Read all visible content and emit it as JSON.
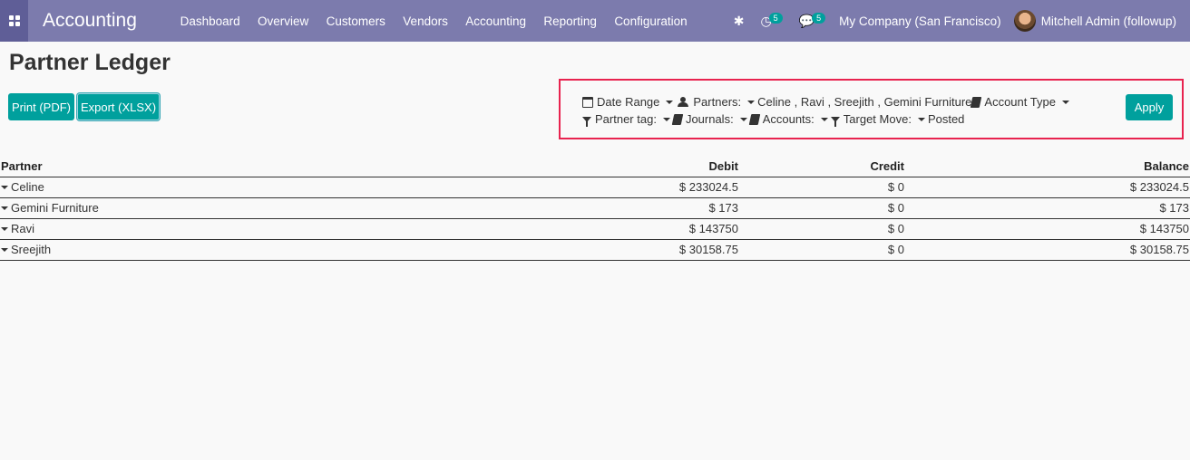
{
  "navbar": {
    "app_name": "Accounting",
    "menu": [
      "Dashboard",
      "Overview",
      "Customers",
      "Vendors",
      "Accounting",
      "Reporting",
      "Configuration"
    ],
    "activity_count": "5",
    "messages_count": "5",
    "company": "My Company (San Francisco)",
    "user": "Mitchell Admin (followup)",
    "icons": [
      "apps-grid-icon",
      "bug-icon",
      "clock-icon",
      "comments-icon"
    ]
  },
  "page": {
    "title": "Partner Ledger",
    "print_label": "Print (PDF)",
    "export_label": "Export (XLSX)",
    "apply_label": "Apply"
  },
  "filters": {
    "date_range": "Date Range",
    "partners_label": "Partners:",
    "partners_value": "Celine , Ravi , Sreejith , Gemini Furniture",
    "account_type": "Account Type",
    "partner_tag": "Partner tag:",
    "journals": "Journals:",
    "accounts": "Accounts:",
    "target_move_label": "Target Move:",
    "target_move_value": "Posted"
  },
  "table": {
    "headers": [
      "Partner",
      "Debit",
      "Credit",
      "Balance"
    ],
    "rows": [
      {
        "partner": "Celine",
        "debit": "$ 233024.5",
        "credit": "$ 0",
        "balance": "$ 233024.5"
      },
      {
        "partner": "Gemini Furniture",
        "debit": "$ 173",
        "credit": "$ 0",
        "balance": "$ 173"
      },
      {
        "partner": "Ravi",
        "debit": "$ 143750",
        "credit": "$ 0",
        "balance": "$ 143750"
      },
      {
        "partner": "Sreejith",
        "debit": "$ 30158.75",
        "credit": "$ 0",
        "balance": "$ 30158.75"
      }
    ]
  },
  "colors": {
    "navbar": "#7c7bad",
    "primary": "#00a09d",
    "highlight_box": "#e8234f"
  }
}
